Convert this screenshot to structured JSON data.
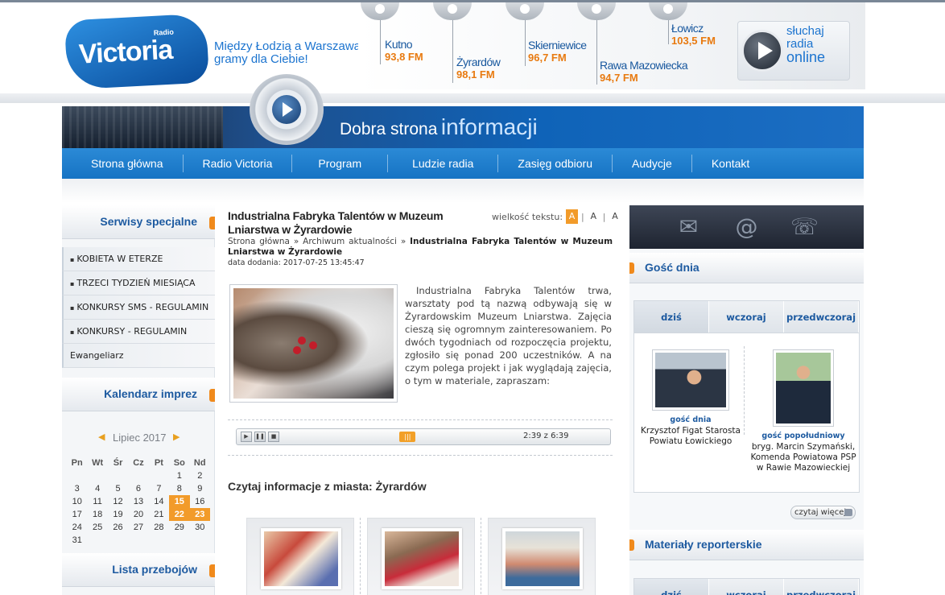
{
  "header": {
    "logo_small": "Radio",
    "logo_name": "Victoria",
    "slogan_line1": "Między Łodzią a Warszawą",
    "slogan_line2": "gramy dla Ciebie!",
    "cities": [
      {
        "name": "Kutno",
        "freq": "93,8 FM"
      },
      {
        "name": "Żyrardów",
        "freq": "98,1 FM"
      },
      {
        "name": "Skierniewice",
        "freq": "96,7 FM"
      },
      {
        "name": "Rawa Mazowiecka",
        "freq": "94,7 FM"
      },
      {
        "name": "Łowicz",
        "freq": "103,5 FM"
      }
    ],
    "online_line1": "słuchaj",
    "online_line2": "radia",
    "online_line3": "online"
  },
  "banner": {
    "part1": "Dobra strona",
    "part2": "informacji"
  },
  "nav": [
    "Strona główna",
    "Radio Victoria",
    "Program",
    "Ludzie radia",
    "Zasięg odbioru",
    "Audycje",
    "Kontakt"
  ],
  "sidebar": {
    "special_title": "Serwisy specjalne",
    "special_items": [
      "KOBIETA W ETERZE",
      "TRZECI TYDZIEŃ MIESIĄCA",
      "KONKURSY SMS - REGULAMIN",
      "KONKURSY - REGULAMIN",
      "Ewangeliarz"
    ],
    "calendar_title": "Kalendarz imprez",
    "calendar_month": "Lipiec 2017",
    "calendar_days": [
      "Pn",
      "Wt",
      "Śr",
      "Cz",
      "Pt",
      "So",
      "Nd"
    ],
    "calendar_weeks": [
      [
        "",
        "",
        "",
        "",
        "",
        "1",
        "2"
      ],
      [
        "3",
        "4",
        "5",
        "6",
        "7",
        "8",
        "9"
      ],
      [
        "10",
        "11",
        "12",
        "13",
        "14",
        "15",
        "16"
      ],
      [
        "17",
        "18",
        "19",
        "20",
        "21",
        "22",
        "23"
      ],
      [
        "24",
        "25",
        "26",
        "27",
        "28",
        "29",
        "30"
      ],
      [
        "31",
        "",
        "",
        "",
        "",
        "",
        ""
      ]
    ],
    "charts_title": "Lista przebojów"
  },
  "article": {
    "title": "Industrialna Fabryka Talentów w Muzeum Lniarstwa w Żyrardowie",
    "text_size_label": "wielkość tekstu:",
    "text_size_options": [
      "A",
      "A",
      "A"
    ],
    "crumb_home": "Strona główna",
    "crumb_sep": "»",
    "crumb_archive": "Archiwum aktualności",
    "crumb_current": "Industrialna Fabryka Talentów w Muzeum Lniarstwa w Żyrardowie",
    "date_label": "data dodania:",
    "date": "2017-07-25 13:45:47",
    "body": "Industrialna Fabryka Talentów trwa, warsztaty pod tą nazwą odbywają się w Żyrardowskim Muzeum Lniarstwa. Zajęcia cieszą się ogromnym zainteresowaniem. Po dwóch tygodniach od rozpoczęcia projektu, zgłosiło się ponad 200 uczestników. A na czym polega projekt i jak wyglądają zajęcia, o tym w materiale, zapraszam:",
    "player_time": "2:39 z 6:39",
    "player_progress": 0.4,
    "city_news": "Czytaj informacje z miasta: Żyrardów"
  },
  "right": {
    "guest_title": "Gość dnia",
    "tabs": [
      "dziś",
      "wczoraj",
      "przedwczoraj"
    ],
    "guest1_label": "gość dnia",
    "guest1_name": "Krzysztof Figat Starosta Powiatu Łowickiego",
    "guest2_label": "gość popołudniowy",
    "guest2_name": "bryg. Marcin Szymański, Komenda Powiatowa PSP w Rawie Mazowieckiej",
    "more": "czytaj więcej",
    "reporter_title": "Materiały reporterskie"
  },
  "colors": {
    "accent": "#1d5aa0",
    "orange": "#f29b2a",
    "nav": "#1673c4"
  }
}
